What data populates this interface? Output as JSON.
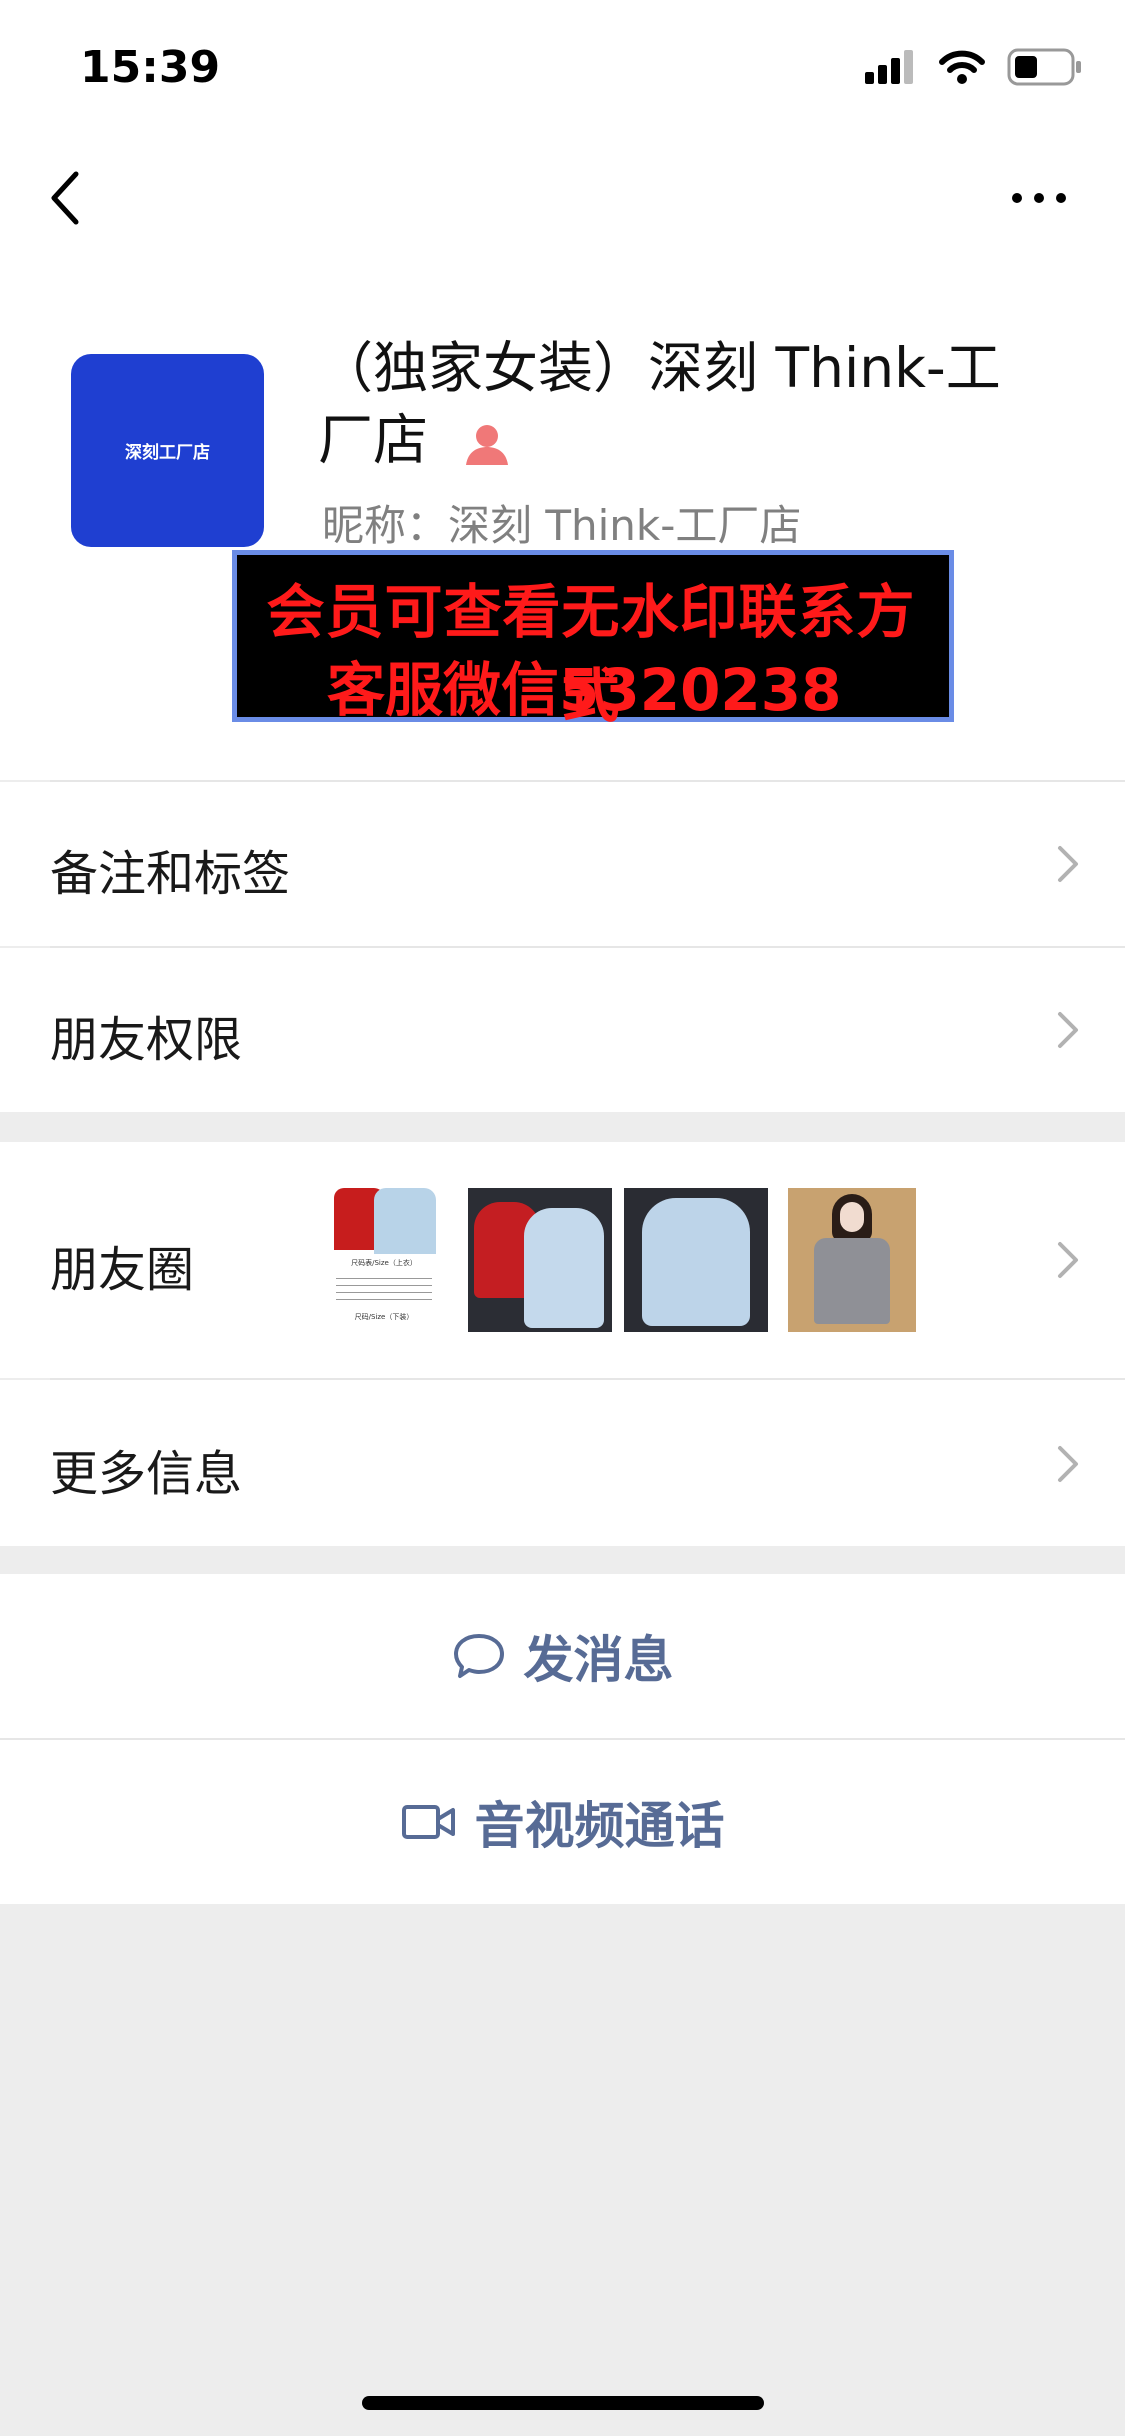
{
  "status_bar": {
    "time": "15:39"
  },
  "profile": {
    "avatar_text": "深刻工厂店",
    "name_line1": "（独家女装）深刻 Think-工",
    "name_line2": "厂店",
    "nickname": "昵称：深刻 Think-工厂店"
  },
  "watermark": {
    "line1": "会员可查看无水印联系方式",
    "line2": "客服微信5320238"
  },
  "menu": {
    "remarks": "备注和标签",
    "permissions": "朋友权限",
    "moments": "朋友圈",
    "more_info": "更多信息"
  },
  "moments_thumbs": [
    {
      "name": "moments-thumb-size-chart",
      "caption_1": "尺码表/Size（上衣）",
      "caption_2": "尺码/Size（下装）"
    },
    {
      "name": "moments-thumb-red-blue-hoodies"
    },
    {
      "name": "moments-thumb-blue-hoodie"
    },
    {
      "name": "moments-thumb-model-photo"
    }
  ],
  "actions": {
    "send_message": "发消息",
    "video_call": "音视频通话"
  },
  "colors": {
    "link": "#576b95",
    "avatar_bg": "#1f3fd1",
    "watermark_text": "#ff1a1a",
    "background": "#ededed"
  }
}
